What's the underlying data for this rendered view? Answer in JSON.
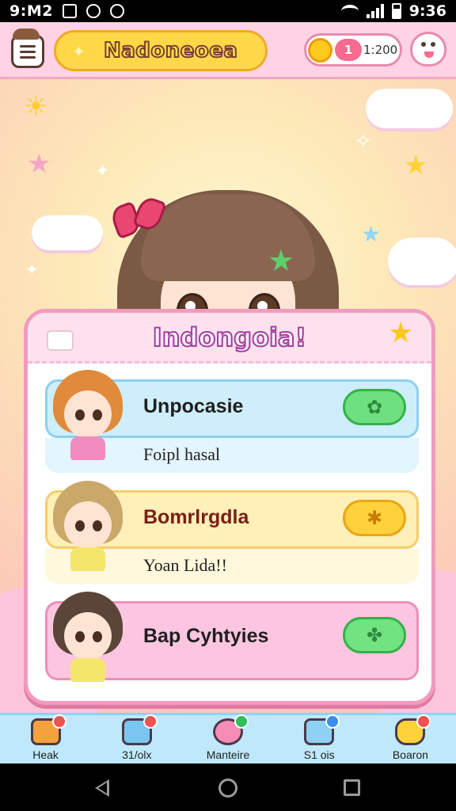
{
  "status_bar": {
    "time_left": "9:M2",
    "time_right": "9:36"
  },
  "app_bar": {
    "title": "Nadoneoea",
    "coin_count": "1",
    "coin_total": "1:200"
  },
  "dialog": {
    "title": "Indongoia!",
    "entries": [
      {
        "name": "Unpocasie",
        "subtitle": "Foipl hasal",
        "theme": "blue",
        "button_icon": "frog-icon"
      },
      {
        "name": "Bomrlrgdla",
        "subtitle": "Yoan Lida!!",
        "theme": "yellow",
        "button_icon": "flower-icon"
      },
      {
        "name": "Bap Cyhtyies",
        "subtitle": "",
        "theme": "pink",
        "button_icon": "clover-icon"
      }
    ]
  },
  "bottom_nav": [
    {
      "label": "Heak",
      "icon": "house-icon",
      "color": "#f5a23c",
      "badge": "#f05252"
    },
    {
      "label": "31/olx",
      "icon": "calendar-icon",
      "color": "#7bc6f0",
      "badge": "#f05252"
    },
    {
      "label": "Manteire",
      "icon": "gift-icon",
      "color": "#f78cb6",
      "badge": "#2fbf5c"
    },
    {
      "label": "S1 ois",
      "icon": "card-icon",
      "color": "#8fd1f5",
      "badge": "#3a8ef0"
    },
    {
      "label": "Boaron",
      "icon": "bear-icon",
      "color": "#ffd23b",
      "badge": "#f05252"
    }
  ],
  "colors": {
    "accent_pink": "#f29abf",
    "title_yellow": "#ffd84a",
    "nav_blue": "#bfe9fb"
  }
}
